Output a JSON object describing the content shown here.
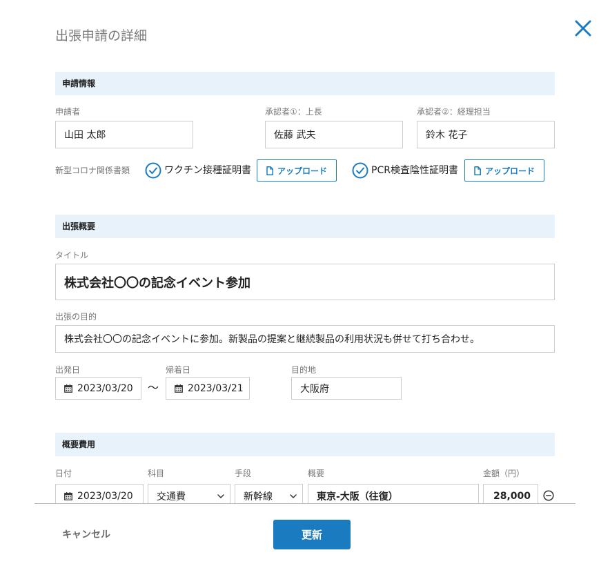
{
  "dialog": {
    "title": "出張申請の詳細"
  },
  "colors": {
    "accent": "#1b7bc1",
    "section_band": "#e8f2fa",
    "field_border": "#cccccc",
    "label_text": "#777777",
    "footer_divider": "#bdbdbd"
  },
  "icons": {
    "close": "close-icon",
    "document_status": "check-circle-icon",
    "upload": "file-icon",
    "date": "calendar-icon",
    "select": "chevron-down-icon",
    "remove_row": "minus-circle-icon"
  },
  "application": {
    "heading": "申請情報",
    "applicant": {
      "label": "申請者",
      "value": "山田 太郎"
    },
    "approver_1": {
      "label": "承認者①：上長",
      "value": "佐藤 武夫"
    },
    "approver_2": {
      "label": "承認者②：経理担当",
      "value": "鈴木 花子"
    },
    "covid_documents": {
      "label": "新型コロナ関係書類",
      "items": [
        {
          "name": "ワクチン接種証明書",
          "verified": true,
          "upload_label": "アップロード"
        },
        {
          "name": "PCR検査陰性証明書",
          "verified": true,
          "upload_label": "アップロード"
        }
      ]
    }
  },
  "overview": {
    "heading": "出張概要",
    "title": {
      "label": "タイトル",
      "value": "株式会社〇〇の記念イベント参加"
    },
    "purpose": {
      "label": "出張の目的",
      "value": "株式会社〇〇の記念イベントに参加。新製品の提案と継続製品の利用状況も併せて打ち合わせ。"
    },
    "departure": {
      "label": "出発日",
      "value": "2023/03/20"
    },
    "date_separator": "〜",
    "arrival": {
      "label": "帰着日",
      "value": "2023/03/21"
    },
    "destination": {
      "label": "目的地",
      "value": "大阪府"
    }
  },
  "expenses": {
    "heading": "概要費用",
    "columns": [
      "日付",
      "科目",
      "手段",
      "概要",
      "金額（円）"
    ],
    "rows": [
      {
        "date": "2023/03/20",
        "category": "交通費",
        "method": "新幹線",
        "summary": "東京-大阪（往復）",
        "amount": "28,000"
      }
    ]
  },
  "footer": {
    "cancel_label": "キャンセル",
    "submit_label": "更新"
  }
}
